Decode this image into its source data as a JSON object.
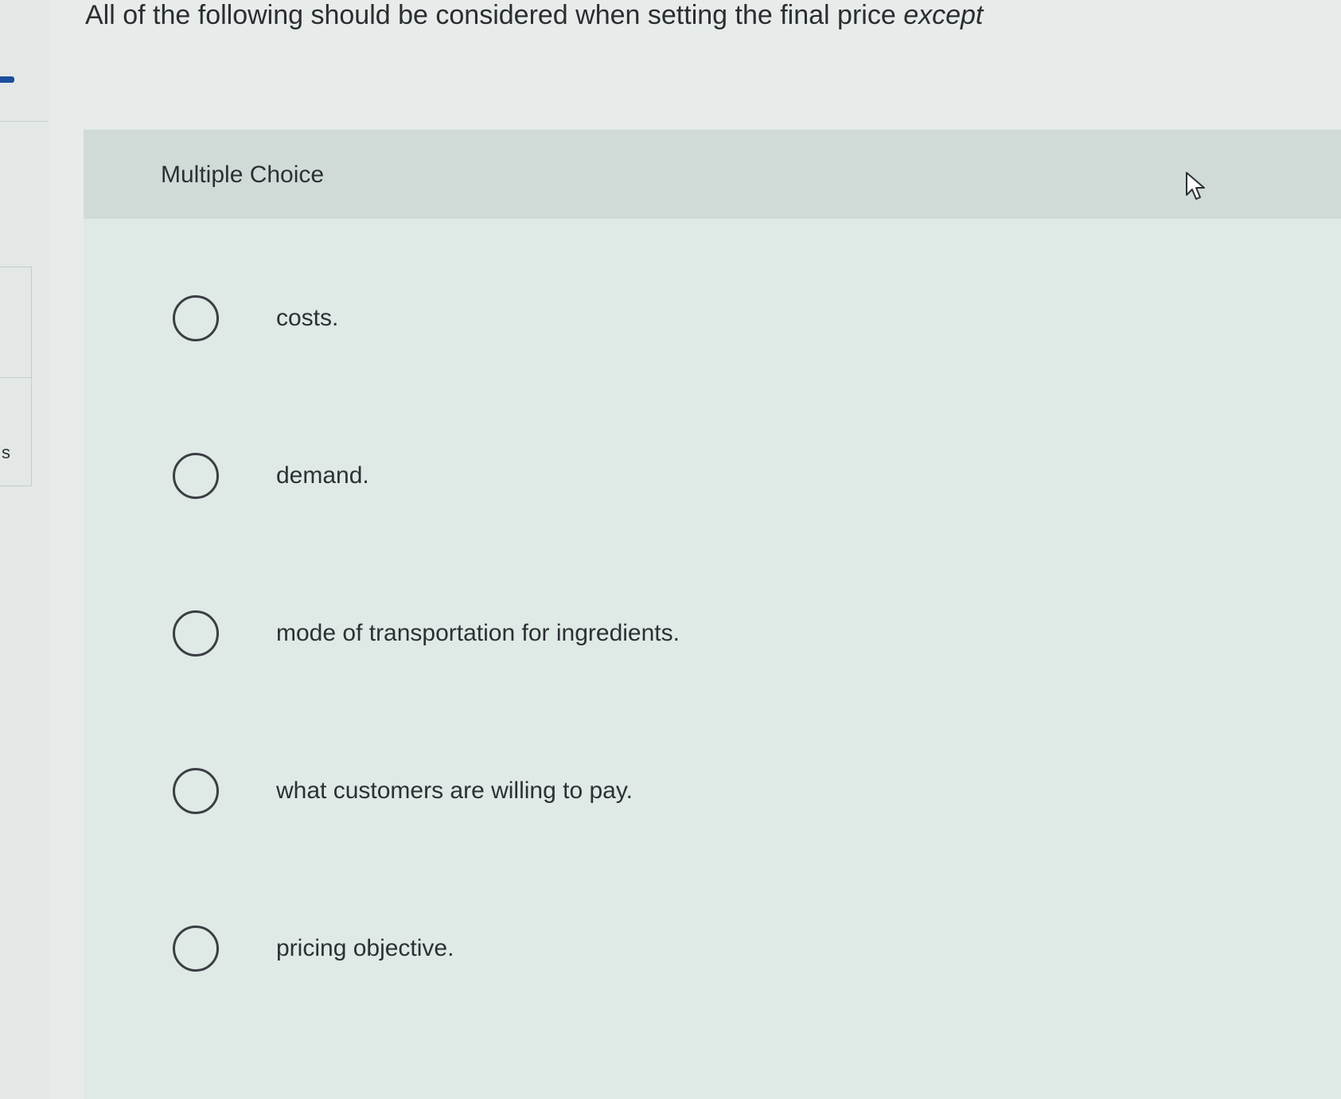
{
  "question": {
    "text": "All of the following should be considered when setting the final price",
    "emphasis": "except"
  },
  "panel": {
    "header_label": "Multiple Choice"
  },
  "options": [
    {
      "label": "costs."
    },
    {
      "label": "demand."
    },
    {
      "label": "mode of transportation for ingredients."
    },
    {
      "label": "what customers are willing to pay."
    },
    {
      "label": "pricing objective."
    }
  ],
  "left_edge": {
    "letter": "s"
  },
  "colors": {
    "background": "#e7ecea",
    "panel": "#dfe9e6",
    "panel_header": "#d0dbd8",
    "text": "#2c3034",
    "accent_mark": "#1b4f9c"
  }
}
